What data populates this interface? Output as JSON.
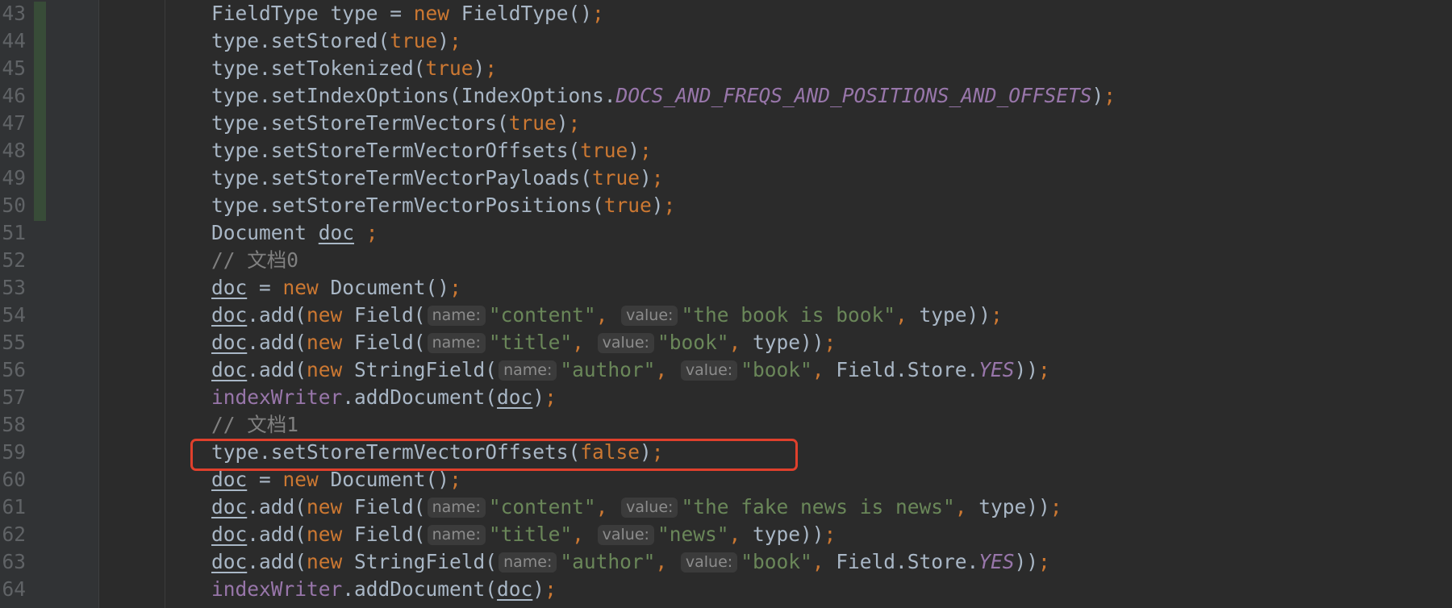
{
  "lines": [
    {
      "n": "43",
      "tokens": [
        {
          "t": "FieldType type = "
        },
        {
          "t": "new",
          "c": "kw"
        },
        {
          "t": " FieldType()"
        },
        {
          "t": ";",
          "c": "kw"
        }
      ]
    },
    {
      "n": "44",
      "tokens": [
        {
          "t": "type.setStored("
        },
        {
          "t": "true",
          "c": "kw"
        },
        {
          "t": ")"
        },
        {
          "t": ";",
          "c": "kw"
        }
      ]
    },
    {
      "n": "45",
      "tokens": [
        {
          "t": "type.setTokenized("
        },
        {
          "t": "true",
          "c": "kw"
        },
        {
          "t": ")"
        },
        {
          "t": ";",
          "c": "kw"
        }
      ]
    },
    {
      "n": "46",
      "tokens": [
        {
          "t": "type.setIndexOptions(IndexOptions."
        },
        {
          "t": "DOCS_AND_FREQS_AND_POSITIONS_AND_OFFSETS",
          "c": "con"
        },
        {
          "t": ")"
        },
        {
          "t": ";",
          "c": "kw"
        }
      ]
    },
    {
      "n": "47",
      "tokens": [
        {
          "t": "type.setStoreTermVectors("
        },
        {
          "t": "true",
          "c": "kw"
        },
        {
          "t": ")"
        },
        {
          "t": ";",
          "c": "kw"
        }
      ]
    },
    {
      "n": "48",
      "tokens": [
        {
          "t": "type.setStoreTermVectorOffsets("
        },
        {
          "t": "true",
          "c": "kw"
        },
        {
          "t": ")"
        },
        {
          "t": ";",
          "c": "kw"
        }
      ]
    },
    {
      "n": "49",
      "tokens": [
        {
          "t": "type.setStoreTermVectorPayloads("
        },
        {
          "t": "true",
          "c": "kw"
        },
        {
          "t": ")"
        },
        {
          "t": ";",
          "c": "kw"
        }
      ]
    },
    {
      "n": "50",
      "tokens": [
        {
          "t": "type.setStoreTermVectorPositions("
        },
        {
          "t": "true",
          "c": "kw"
        },
        {
          "t": ")"
        },
        {
          "t": ";",
          "c": "kw"
        }
      ]
    },
    {
      "n": "51",
      "tokens": [
        {
          "t": "Document "
        },
        {
          "t": "doc",
          "c": "var"
        },
        {
          "t": " "
        },
        {
          "t": ";",
          "c": "kw"
        }
      ]
    },
    {
      "n": "52",
      "tokens": [
        {
          "t": "// 文档0",
          "c": "cmt"
        }
      ]
    },
    {
      "n": "53",
      "tokens": [
        {
          "t": "doc",
          "c": "var"
        },
        {
          "t": " = "
        },
        {
          "t": "new",
          "c": "kw"
        },
        {
          "t": " Document()"
        },
        {
          "t": ";",
          "c": "kw"
        }
      ]
    },
    {
      "n": "54",
      "tokens": [
        {
          "t": "doc",
          "c": "var"
        },
        {
          "t": ".add("
        },
        {
          "t": "new",
          "c": "kw"
        },
        {
          "t": " Field("
        },
        {
          "t": "name:",
          "c": "hint"
        },
        {
          "t": "\"content\"",
          "c": "str"
        },
        {
          "t": ", ",
          "c": "kw"
        },
        {
          "t": "value:",
          "c": "hint"
        },
        {
          "t": "\"the book is book\"",
          "c": "str"
        },
        {
          "t": ", ",
          "c": "kw"
        },
        {
          "t": "type))"
        },
        {
          "t": ";",
          "c": "kw"
        }
      ]
    },
    {
      "n": "55",
      "tokens": [
        {
          "t": "doc",
          "c": "var"
        },
        {
          "t": ".add("
        },
        {
          "t": "new",
          "c": "kw"
        },
        {
          "t": " Field("
        },
        {
          "t": "name:",
          "c": "hint"
        },
        {
          "t": "\"title\"",
          "c": "str"
        },
        {
          "t": ", ",
          "c": "kw"
        },
        {
          "t": "value:",
          "c": "hint"
        },
        {
          "t": "\"book\"",
          "c": "str"
        },
        {
          "t": ", ",
          "c": "kw"
        },
        {
          "t": "type))"
        },
        {
          "t": ";",
          "c": "kw"
        }
      ]
    },
    {
      "n": "56",
      "tokens": [
        {
          "t": "doc",
          "c": "var"
        },
        {
          "t": ".add("
        },
        {
          "t": "new",
          "c": "kw"
        },
        {
          "t": " StringField("
        },
        {
          "t": "name:",
          "c": "hint"
        },
        {
          "t": "\"author\"",
          "c": "str"
        },
        {
          "t": ", ",
          "c": "kw"
        },
        {
          "t": "value:",
          "c": "hint"
        },
        {
          "t": "\"book\"",
          "c": "str"
        },
        {
          "t": ", ",
          "c": "kw"
        },
        {
          "t": "Field.Store."
        },
        {
          "t": "YES",
          "c": "con"
        },
        {
          "t": "))"
        },
        {
          "t": ";",
          "c": "kw"
        }
      ]
    },
    {
      "n": "57",
      "tokens": [
        {
          "t": "indexWriter",
          "c": "fld"
        },
        {
          "t": ".addDocument("
        },
        {
          "t": "doc",
          "c": "var"
        },
        {
          "t": ")"
        },
        {
          "t": ";",
          "c": "kw"
        }
      ]
    },
    {
      "n": "58",
      "tokens": [
        {
          "t": "// 文档1",
          "c": "cmt"
        }
      ]
    },
    {
      "n": "59",
      "tokens": [
        {
          "t": "type.setStoreTermVectorOffsets("
        },
        {
          "t": "false",
          "c": "kw"
        },
        {
          "t": ")"
        },
        {
          "t": ";",
          "c": "kw"
        }
      ]
    },
    {
      "n": "60",
      "tokens": [
        {
          "t": "doc",
          "c": "var"
        },
        {
          "t": " = "
        },
        {
          "t": "new",
          "c": "kw"
        },
        {
          "t": " Document()"
        },
        {
          "t": ";",
          "c": "kw"
        }
      ]
    },
    {
      "n": "61",
      "tokens": [
        {
          "t": "doc",
          "c": "var"
        },
        {
          "t": ".add("
        },
        {
          "t": "new",
          "c": "kw"
        },
        {
          "t": " Field("
        },
        {
          "t": "name:",
          "c": "hint"
        },
        {
          "t": "\"content\"",
          "c": "str"
        },
        {
          "t": ", ",
          "c": "kw"
        },
        {
          "t": "value:",
          "c": "hint"
        },
        {
          "t": "\"the fake news is news\"",
          "c": "str"
        },
        {
          "t": ", ",
          "c": "kw"
        },
        {
          "t": "type))"
        },
        {
          "t": ";",
          "c": "kw"
        }
      ]
    },
    {
      "n": "62",
      "tokens": [
        {
          "t": "doc",
          "c": "var"
        },
        {
          "t": ".add("
        },
        {
          "t": "new",
          "c": "kw"
        },
        {
          "t": " Field("
        },
        {
          "t": "name:",
          "c": "hint"
        },
        {
          "t": "\"title\"",
          "c": "str"
        },
        {
          "t": ", ",
          "c": "kw"
        },
        {
          "t": "value:",
          "c": "hint"
        },
        {
          "t": "\"news\"",
          "c": "str"
        },
        {
          "t": ", ",
          "c": "kw"
        },
        {
          "t": "type))"
        },
        {
          "t": ";",
          "c": "kw"
        }
      ]
    },
    {
      "n": "63",
      "tokens": [
        {
          "t": "doc",
          "c": "var"
        },
        {
          "t": ".add("
        },
        {
          "t": "new",
          "c": "kw"
        },
        {
          "t": " StringField("
        },
        {
          "t": "name:",
          "c": "hint"
        },
        {
          "t": "\"author\"",
          "c": "str"
        },
        {
          "t": ", ",
          "c": "kw"
        },
        {
          "t": "value:",
          "c": "hint"
        },
        {
          "t": "\"book\"",
          "c": "str"
        },
        {
          "t": ", ",
          "c": "kw"
        },
        {
          "t": "Field.Store."
        },
        {
          "t": "YES",
          "c": "con"
        },
        {
          "t": "))"
        },
        {
          "t": ";",
          "c": "kw"
        }
      ]
    },
    {
      "n": "64",
      "tokens": [
        {
          "t": "indexWriter",
          "c": "fld"
        },
        {
          "t": ".addDocument("
        },
        {
          "t": "doc",
          "c": "var"
        },
        {
          "t": ")"
        },
        {
          "t": ";",
          "c": "kw"
        }
      ]
    }
  ],
  "colors": {
    "background": "#2b2b2b",
    "keyword": "#cc7832",
    "string": "#6a8759",
    "constant": "#9876aa",
    "comment": "#808080",
    "default": "#a9b7c6",
    "highlight_box": "#e0402c"
  }
}
